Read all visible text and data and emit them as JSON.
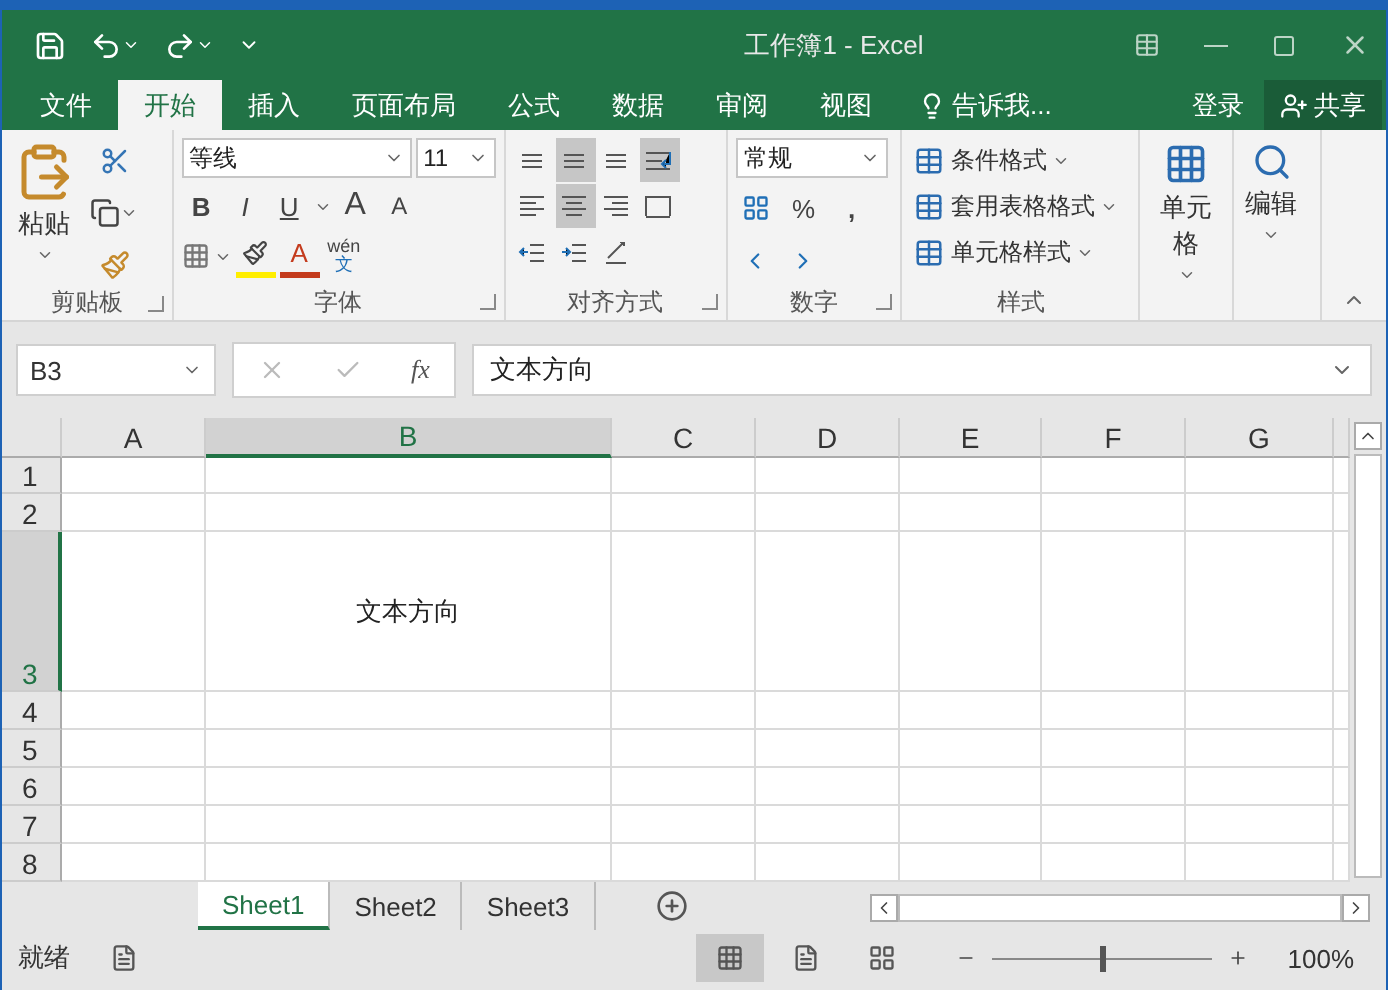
{
  "window": {
    "title": "工作簿1 - Excel"
  },
  "ribbon_tabs": [
    {
      "label": "文件",
      "selected": false
    },
    {
      "label": "开始",
      "selected": true
    },
    {
      "label": "插入",
      "selected": false
    },
    {
      "label": "页面布局",
      "selected": false
    },
    {
      "label": "公式",
      "selected": false
    },
    {
      "label": "数据",
      "selected": false
    },
    {
      "label": "审阅",
      "selected": false
    },
    {
      "label": "视图",
      "selected": false
    }
  ],
  "tell_me": "告诉我...",
  "account": {
    "sign_in": "登录",
    "share": "共享"
  },
  "clipboard": {
    "paste": "粘贴",
    "label": "剪贴板"
  },
  "font": {
    "name": "等线",
    "size": "11",
    "bold": "B",
    "italic": "I",
    "underline": "U",
    "grow": "A",
    "shrink": "A",
    "color_letter": "A",
    "phonetic": "wén",
    "phonetic_char": "文",
    "label": "字体"
  },
  "alignment": {
    "label": "对齐方式",
    "buttons": [
      {
        "kind": "top",
        "selected": false
      },
      {
        "kind": "middle",
        "selected": true
      },
      {
        "kind": "bottom",
        "selected": false
      },
      {
        "kind": "wrap",
        "selected": true
      },
      {
        "kind": "left",
        "selected": false
      },
      {
        "kind": "center",
        "selected": true
      },
      {
        "kind": "right",
        "selected": false
      },
      {
        "kind": "merge",
        "selected": false
      },
      {
        "kind": "outdent",
        "selected": false
      },
      {
        "kind": "indent",
        "selected": false
      },
      {
        "kind": "orientation",
        "selected": false
      }
    ]
  },
  "number": {
    "format": "常规",
    "percent": "%",
    "comma": ",",
    "label": "数字"
  },
  "styles": {
    "items": [
      "条件格式",
      "套用表格格式",
      "单元格样式"
    ],
    "label": "样式"
  },
  "cells": {
    "label": "单元格"
  },
  "editing": {
    "label": "编辑"
  },
  "formula_bar": {
    "name_box": "B3",
    "function_label": "fx",
    "formula": "文本方向"
  },
  "columns": [
    {
      "label": "A",
      "selected": false
    },
    {
      "label": "B",
      "selected": true
    },
    {
      "label": "C",
      "selected": false
    },
    {
      "label": "D",
      "selected": false
    },
    {
      "label": "E",
      "selected": false
    },
    {
      "label": "F",
      "selected": false
    },
    {
      "label": "G",
      "selected": false
    }
  ],
  "rows": [
    {
      "label": "1",
      "selected": false
    },
    {
      "label": "2",
      "selected": false
    },
    {
      "label": "3",
      "selected": true,
      "cells": [
        null,
        "文本方向"
      ]
    },
    {
      "label": "4",
      "selected": false
    },
    {
      "label": "5",
      "selected": false
    },
    {
      "label": "6",
      "selected": false
    },
    {
      "label": "7",
      "selected": false
    },
    {
      "label": "8",
      "selected": false
    }
  ],
  "sheets": [
    {
      "label": "Sheet1",
      "selected": true
    },
    {
      "label": "Sheet2",
      "selected": false
    },
    {
      "label": "Sheet3",
      "selected": false
    }
  ],
  "status": {
    "text": "就绪",
    "zoom": "100%",
    "zoom_slider": {
      "level": 0.5
    },
    "views": [
      {
        "kind": "normal",
        "selected": true
      },
      {
        "kind": "page_layout",
        "selected": false
      },
      {
        "kind": "page_break",
        "selected": false
      }
    ]
  }
}
